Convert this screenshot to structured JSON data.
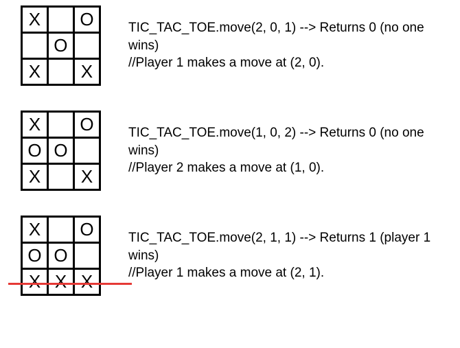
{
  "steps": [
    {
      "board": {
        "r0": {
          "c0": "X",
          "c1": "",
          "c2": "O"
        },
        "r1": {
          "c0": "",
          "c1": "O",
          "c2": ""
        },
        "r2": {
          "c0": "X",
          "c1": "",
          "c2": "X"
        }
      },
      "line1": "TIC_TAC_TOE.move(2, 0, 1) --> Returns 0 (no one wins)",
      "line2": "//Player 1 makes a move at (2, 0)."
    },
    {
      "board": {
        "r0": {
          "c0": "X",
          "c1": "",
          "c2": "O"
        },
        "r1": {
          "c0": "O",
          "c1": "O",
          "c2": ""
        },
        "r2": {
          "c0": "X",
          "c1": "",
          "c2": "X"
        }
      },
      "line1": "TIC_TAC_TOE.move(1, 0, 2) --> Returns 0 (no one wins)",
      "line2": "//Player 2 makes a move at (1, 0)."
    },
    {
      "board": {
        "r0": {
          "c0": "X",
          "c1": "",
          "c2": "O"
        },
        "r1": {
          "c0": "O",
          "c1": "O",
          "c2": ""
        },
        "r2": {
          "c0": "X",
          "c1": "X",
          "c2": "X"
        }
      },
      "line1": "TIC_TAC_TOE.move(2, 1, 1) --> Returns 1 (player 1 wins)",
      "line2": "//Player 1 makes a move at (2, 1).",
      "win_row": 2
    }
  ]
}
